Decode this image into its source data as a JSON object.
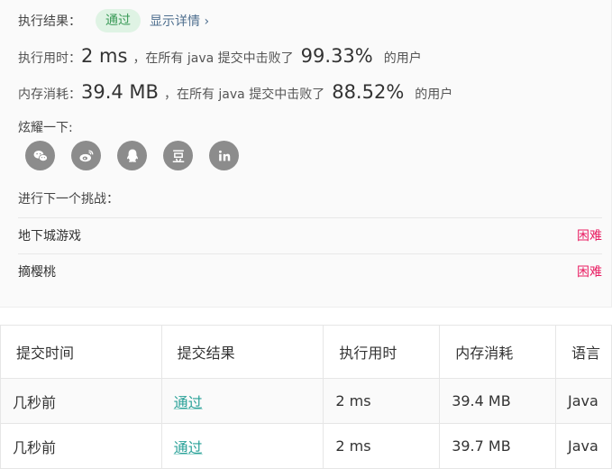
{
  "result": {
    "label": "执行结果：",
    "status": "通过",
    "detail_link": "显示详情",
    "detail_chevron": "›"
  },
  "runtime": {
    "label": "执行用时：",
    "value": "2 ms",
    "mid_text": "，在所有 java 提交中击败了",
    "percent": "99.33%",
    "suffix": "的用户"
  },
  "memory": {
    "label": "内存消耗：",
    "value": "39.4 MB",
    "mid_text": "，在所有 java 提交中击败了",
    "percent": "88.52%",
    "suffix": "的用户"
  },
  "share": {
    "label": "炫耀一下:",
    "icons": [
      "wechat-icon",
      "weibo-icon",
      "qq-icon",
      "douban-icon",
      "linkedin-icon"
    ],
    "icon_bg": "#8c8c8c"
  },
  "next_challenge": {
    "label": "进行下一个挑战：",
    "problems": [
      {
        "title": "地下城游戏",
        "difficulty": "困难"
      },
      {
        "title": "摘樱桃",
        "difficulty": "困难"
      }
    ],
    "difficulty_color": "#e91e63"
  },
  "submissions": {
    "headers": [
      "提交时间",
      "提交结果",
      "执行用时",
      "内存消耗",
      "语言"
    ],
    "rows": [
      {
        "time": "几秒前",
        "result": "通过",
        "runtime": "2 ms",
        "memory": "39.4 MB",
        "lang": "Java"
      },
      {
        "time": "几秒前",
        "result": "通过",
        "runtime": "2 ms",
        "memory": "39.7 MB",
        "lang": "Java"
      }
    ]
  }
}
